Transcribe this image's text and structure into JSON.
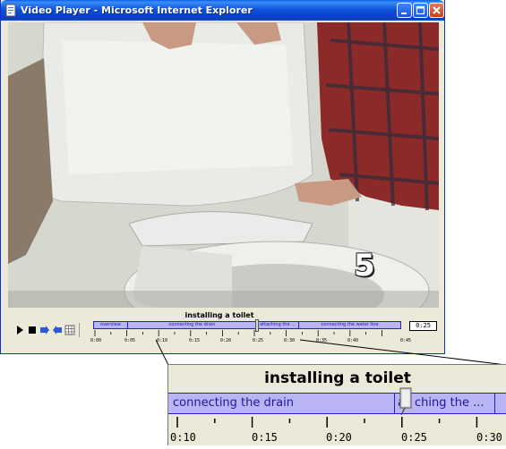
{
  "window": {
    "title": "Video Player - Microsoft Internet Explorer",
    "title_icon": "ie-page-icon",
    "buttons": [
      {
        "name": "minimize",
        "icon": "minimize-icon"
      },
      {
        "name": "maximize",
        "icon": "maximize-icon"
      },
      {
        "name": "close",
        "icon": "close-icon"
      }
    ]
  },
  "video": {
    "overlay_number": "5"
  },
  "player": {
    "clip_title": "installing a toilet",
    "current_time": "0:25",
    "buttons": [
      {
        "name": "play",
        "icon": "play-icon"
      },
      {
        "name": "stop",
        "icon": "stop-icon"
      },
      {
        "name": "next-segment",
        "icon": "next-segment-icon"
      },
      {
        "name": "previous-segment",
        "icon": "previous-segment-icon"
      },
      {
        "name": "table-of-contents",
        "icon": "grid-icon"
      }
    ],
    "segments": [
      "overview",
      "connecting the drain",
      "attaching the ...",
      "connecting the water line"
    ],
    "tick_labels": [
      "0:00",
      "0:05",
      "0:10",
      "0:15",
      "0:20",
      "0:25",
      "0:30",
      "0:35",
      "0:40",
      "0:45"
    ],
    "playhead_time_seconds": 25
  },
  "zoom": {
    "clip_title": "installing a toilet",
    "segment_left": "connecting the drain",
    "segment_right_prefix": "a",
    "segment_right_suffix": "ching the ...",
    "tick_labels": [
      "0:10",
      "0:15",
      "0:20",
      "0:25",
      "0:30"
    ]
  },
  "colors": {
    "titlebar": "#0a4fd7",
    "segment_fill": "#b9b4f4",
    "segment_text": "#1a1aa0",
    "window_bg": "#ece9d8"
  }
}
